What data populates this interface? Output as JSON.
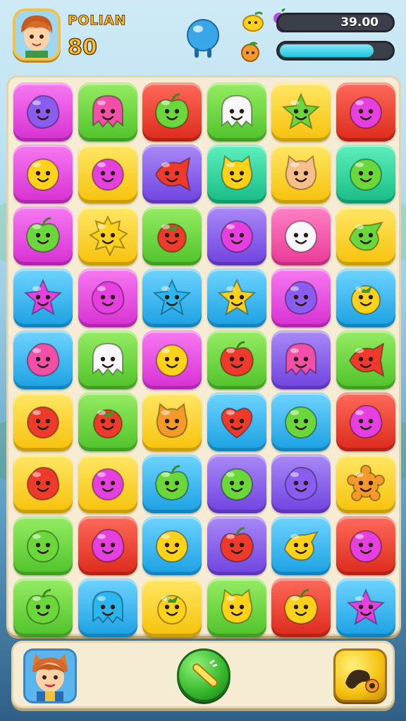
{
  "header": {
    "player_name": "POLIAN",
    "score": "80",
    "coins": "39.00",
    "coin_bar_fill": 0.97,
    "energy_bar_fill": 0.82,
    "icons": [
      "player-avatar-icon",
      "water-drop-icon",
      "lemon-icon",
      "grapes-icon",
      "peach-icon"
    ]
  },
  "colors": {
    "magenta": "#e53fe0",
    "green": "#6ad83a",
    "red": "#ee3a2a",
    "yellow": "#ffd21a",
    "blue": "#2ab6ef",
    "purple": "#8a5cf0",
    "teal": "#27d09a",
    "pink": "#f24fa9",
    "energy": "#2fd3ea",
    "coin_bar": "#3b3f4a"
  },
  "board": {
    "rows": 9,
    "cols": 6,
    "tiles": [
      [
        {
          "bg": "magenta",
          "fg": "purple",
          "shape": "blob"
        },
        {
          "bg": "green",
          "fg": "pink",
          "shape": "ghost"
        },
        {
          "bg": "red",
          "fg": "green",
          "shape": "apple"
        },
        {
          "bg": "green",
          "fg": "white",
          "shape": "ghost"
        },
        {
          "bg": "yellow",
          "fg": "green",
          "shape": "star"
        },
        {
          "bg": "red",
          "fg": "magenta",
          "shape": "circle"
        }
      ],
      [
        {
          "bg": "magenta",
          "fg": "yellow",
          "shape": "circle"
        },
        {
          "bg": "yellow",
          "fg": "magenta",
          "shape": "circle"
        },
        {
          "bg": "purple",
          "fg": "red",
          "shape": "fish"
        },
        {
          "bg": "teal",
          "fg": "yellow",
          "shape": "cat"
        },
        {
          "bg": "yellow",
          "fg": "peach",
          "shape": "cat"
        },
        {
          "bg": "teal",
          "fg": "green",
          "shape": "circle"
        }
      ],
      [
        {
          "bg": "magenta",
          "fg": "green",
          "shape": "apple"
        },
        {
          "bg": "yellow",
          "fg": "yellow",
          "shape": "sun"
        },
        {
          "bg": "green",
          "fg": "red",
          "shape": "berry"
        },
        {
          "bg": "purple",
          "fg": "magenta",
          "shape": "circle"
        },
        {
          "bg": "pink",
          "fg": "white",
          "shape": "circle"
        },
        {
          "bg": "yellow",
          "fg": "green",
          "shape": "bird"
        }
      ],
      [
        {
          "bg": "blue",
          "fg": "magenta",
          "shape": "star"
        },
        {
          "bg": "magenta",
          "fg": "magenta",
          "shape": "blob"
        },
        {
          "bg": "blue",
          "fg": "blue",
          "shape": "star"
        },
        {
          "bg": "blue",
          "fg": "yellow",
          "shape": "star"
        },
        {
          "bg": "magenta",
          "fg": "purple",
          "shape": "blob"
        },
        {
          "bg": "blue",
          "fg": "yellow",
          "shape": "berry"
        }
      ],
      [
        {
          "bg": "blue",
          "fg": "pink",
          "shape": "blob"
        },
        {
          "bg": "green",
          "fg": "white",
          "shape": "ghost"
        },
        {
          "bg": "magenta",
          "fg": "yellow",
          "shape": "circle"
        },
        {
          "bg": "green",
          "fg": "red",
          "shape": "apple"
        },
        {
          "bg": "purple",
          "fg": "pink",
          "shape": "ghost"
        },
        {
          "bg": "green",
          "fg": "red",
          "shape": "fish"
        }
      ],
      [
        {
          "bg": "yellow",
          "fg": "red",
          "shape": "circle"
        },
        {
          "bg": "green",
          "fg": "red",
          "shape": "berry"
        },
        {
          "bg": "yellow",
          "fg": "orange",
          "shape": "cat"
        },
        {
          "bg": "blue",
          "fg": "red",
          "shape": "heart"
        },
        {
          "bg": "blue",
          "fg": "green",
          "shape": "circle"
        },
        {
          "bg": "red",
          "fg": "magenta",
          "shape": "blob"
        }
      ],
      [
        {
          "bg": "yellow",
          "fg": "red",
          "shape": "blob"
        },
        {
          "bg": "yellow",
          "fg": "magenta",
          "shape": "circle"
        },
        {
          "bg": "blue",
          "fg": "green",
          "shape": "apple"
        },
        {
          "bg": "purple",
          "fg": "green",
          "shape": "circle"
        },
        {
          "bg": "purple",
          "fg": "purple",
          "shape": "blob"
        },
        {
          "bg": "yellow",
          "fg": "orange",
          "shape": "flower"
        }
      ],
      [
        {
          "bg": "green",
          "fg": "green",
          "shape": "circle"
        },
        {
          "bg": "red",
          "fg": "magenta",
          "shape": "blob"
        },
        {
          "bg": "blue",
          "fg": "yellow",
          "shape": "circle"
        },
        {
          "bg": "purple",
          "fg": "red",
          "shape": "apple"
        },
        {
          "bg": "blue",
          "fg": "yellow",
          "shape": "bird"
        },
        {
          "bg": "red",
          "fg": "magenta",
          "shape": "circle"
        }
      ],
      [
        {
          "bg": "green",
          "fg": "green",
          "shape": "apple"
        },
        {
          "bg": "blue",
          "fg": "blue",
          "shape": "ghost"
        },
        {
          "bg": "yellow",
          "fg": "yellow",
          "shape": "berry"
        },
        {
          "bg": "green",
          "fg": "yellow",
          "shape": "cat"
        },
        {
          "bg": "red",
          "fg": "yellow",
          "shape": "apple"
        },
        {
          "bg": "blue",
          "fg": "magenta",
          "shape": "star"
        }
      ]
    ]
  },
  "footer": {
    "icons": [
      "hero-avatar-icon",
      "hammer-icon",
      "bomb-icon"
    ]
  }
}
